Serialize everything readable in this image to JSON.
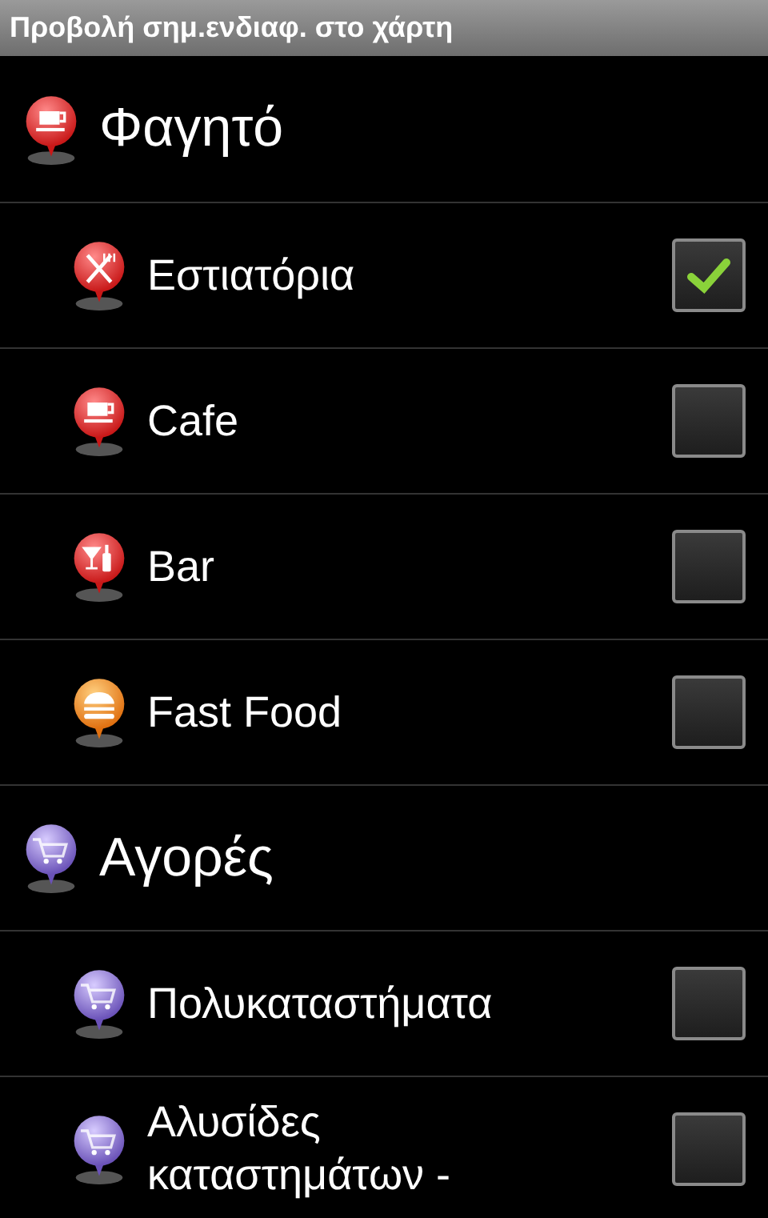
{
  "window": {
    "title": "Προβολή σημ.ενδιαφ. στο χάρτη"
  },
  "groups": [
    {
      "label": "Φαγητό",
      "kind": "cup",
      "items": [
        {
          "label": "Εστιατόρια",
          "kind": "cutlery",
          "checked": true
        },
        {
          "label": "Cafe",
          "kind": "cup",
          "checked": false
        },
        {
          "label": "Bar",
          "kind": "bar",
          "checked": false
        },
        {
          "label": "Fast Food",
          "kind": "burger",
          "checked": false
        }
      ]
    },
    {
      "label": "Αγορές",
      "kind": "cart",
      "items": [
        {
          "label": "Πολυκαταστήματα",
          "kind": "cart",
          "checked": false
        },
        {
          "label": "Αλυσίδες καταστημάτων -",
          "kind": "cart",
          "checked": false
        }
      ]
    }
  ]
}
